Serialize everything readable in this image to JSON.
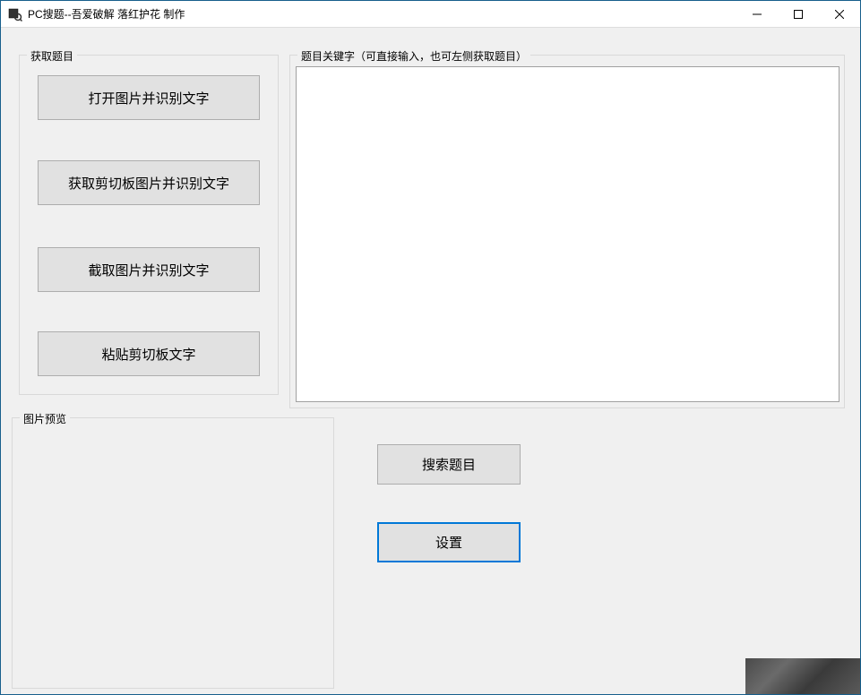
{
  "window": {
    "title": "PC搜题--吾爱破解 落红护花 制作"
  },
  "groupboxes": {
    "acquire": {
      "label": "获取题目"
    },
    "keyword": {
      "label": "题目关键字（可直接输入，也可左侧获取题目）"
    },
    "preview": {
      "label": "图片预览"
    }
  },
  "buttons": {
    "open_image": "打开图片并识别文字",
    "clipboard_image": "获取剪切板图片并识别文字",
    "capture_image": "截取图片并识别文字",
    "paste_text": "粘贴剪切板文字",
    "search": "搜索题目",
    "settings": "设置"
  },
  "textarea": {
    "keyword_value": ""
  }
}
